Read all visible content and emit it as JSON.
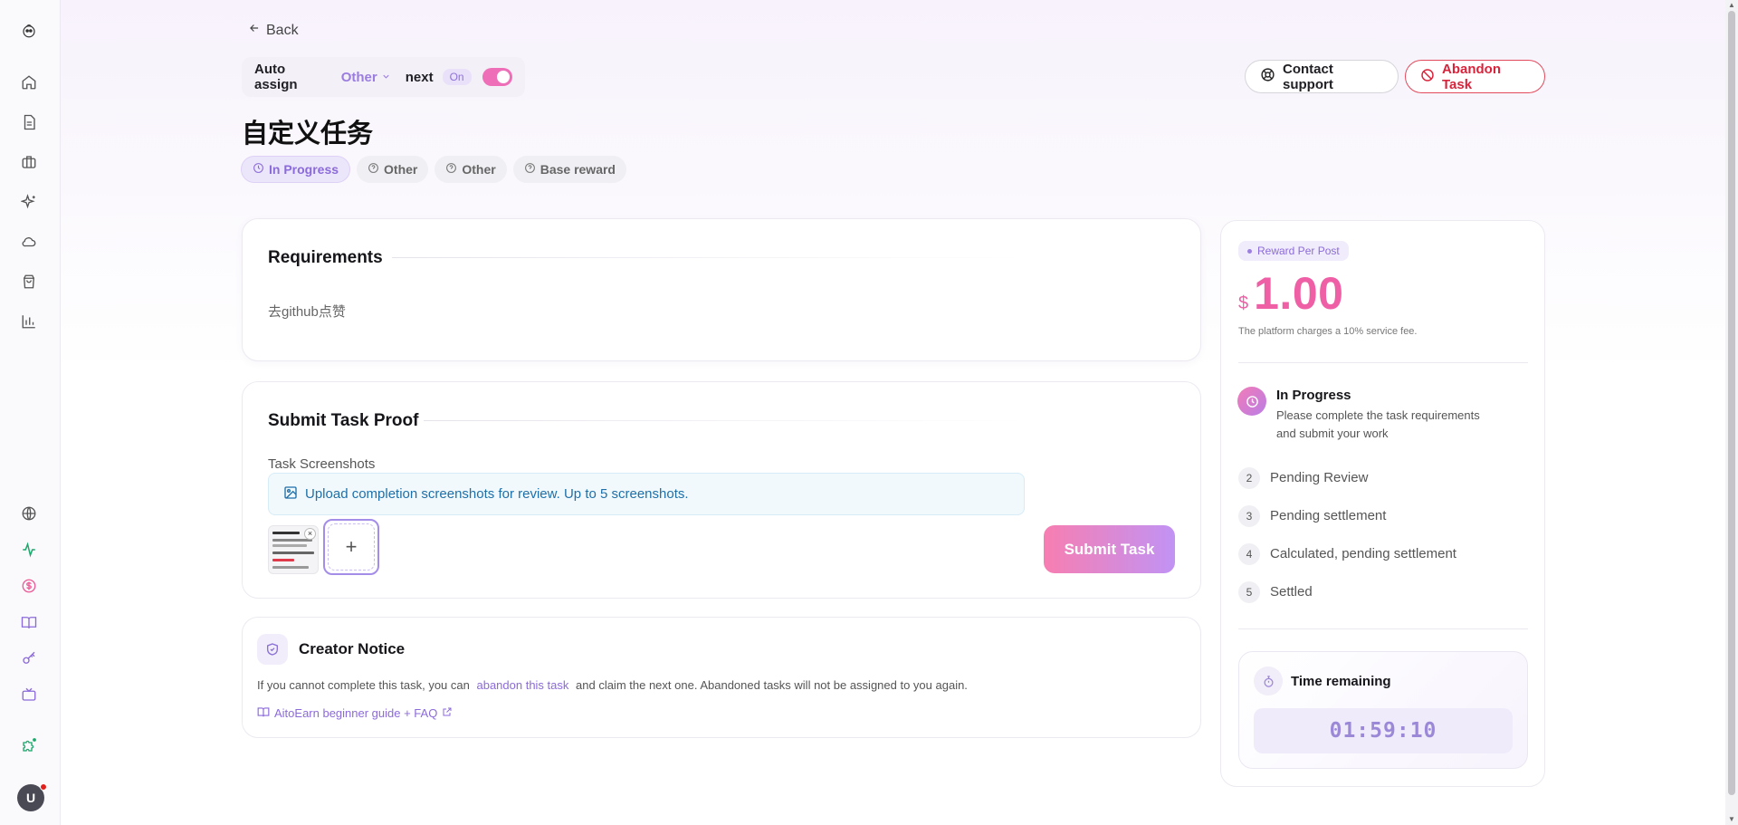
{
  "nav": {
    "back_label": "Back"
  },
  "auto_assign": {
    "label": "Auto assign",
    "selected": "Other",
    "next_label": "next",
    "status": "On"
  },
  "actions": {
    "contact_support": "Contact support",
    "abandon_task": "Abandon Task"
  },
  "task": {
    "title": "自定义任务",
    "tags": [
      "In Progress",
      "Other",
      "Other",
      "Base reward"
    ]
  },
  "requirements": {
    "title": "Requirements",
    "text": "去github点赞"
  },
  "submit": {
    "title": "Submit Task Proof",
    "screenshots_label": "Task Screenshots",
    "upload_info": "Upload completion screenshots for review. Up to 5 screenshots.",
    "add_symbol": "+",
    "remove_symbol": "×",
    "submit_label": "Submit Task"
  },
  "notice": {
    "title": "Creator Notice",
    "text_before": "If you cannot complete this task, you can",
    "link": "abandon this task",
    "text_after": "and claim the next one. Abandoned tasks will not be assigned to you again.",
    "guide": "AitoEarn beginner guide + FAQ"
  },
  "reward": {
    "badge": "Reward Per Post",
    "currency": "$",
    "amount": "1.00",
    "fee_note": "The platform charges a 10% service fee.",
    "color": "#ee5fa6"
  },
  "steps": [
    {
      "num": "",
      "label": "In Progress",
      "desc": "Please complete the task requirements and submit your work"
    },
    {
      "num": "2",
      "label": "Pending Review"
    },
    {
      "num": "3",
      "label": "Pending settlement"
    },
    {
      "num": "4",
      "label": "Calculated, pending settlement"
    },
    {
      "num": "5",
      "label": "Settled"
    }
  ],
  "timer": {
    "label": "Time remaining",
    "value": "01:59:10"
  },
  "user": {
    "avatar_initial": "U"
  },
  "sidebar_icons": [
    "logo-icon",
    "home-icon",
    "document-icon",
    "briefcase-icon",
    "sparkle-icon",
    "cloud-icon",
    "shopping-bag-icon",
    "bar-chart-icon",
    "globe-icon",
    "activity-icon",
    "dollar-icon",
    "book-icon",
    "key-icon",
    "tv-icon",
    "puzzle-icon"
  ]
}
